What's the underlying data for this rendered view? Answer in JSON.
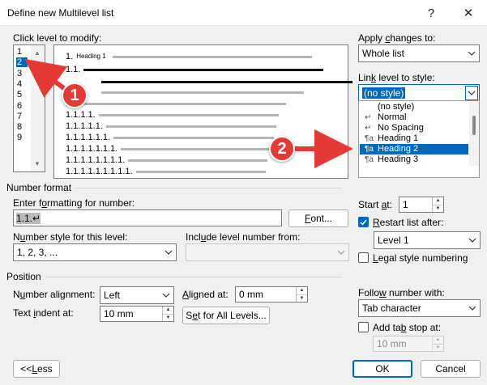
{
  "window": {
    "title": "Define new Multilevel list",
    "help": "?",
    "close": "✕"
  },
  "levels": {
    "label": "Click level to modify:",
    "items": [
      "1",
      "2",
      "3",
      "4",
      "5",
      "6",
      "7",
      "8",
      "9"
    ],
    "selected_index": 1
  },
  "preview": {
    "rows": [
      "1.",
      "1.1.",
      "",
      "",
      "1.",
      "1.1.",
      "1.1.1.1.",
      "1.1.1.1.1.",
      "1.1.1.1.1.1.",
      "1.1.1.1.1.1.1.",
      "1.1.1.1.1.1.1.1.",
      "1.1.1.1.1.1.1.1.1."
    ],
    "heading_label": "Heading 1"
  },
  "apply_changes": {
    "label": "Apply changes to:",
    "value": "Whole list"
  },
  "link_level": {
    "label": "Link level to style:",
    "value": "(no style)",
    "options": [
      "(no style)",
      "Normal",
      "No Spacing",
      "Heading 1",
      "Heading 2",
      "Heading 3"
    ],
    "option_icons": [
      "",
      "↵",
      "↵",
      "¶a",
      "¶a",
      "¶a"
    ],
    "selected_index": 4
  },
  "number_format": {
    "section": "Number format",
    "enter_label": "Enter formatting for number:",
    "format_value": "1.1.↵",
    "font_button": "Font...",
    "style_label": "Number style for this level:",
    "style_value": "1, 2, 3, ...",
    "include_label": "Include level number from:",
    "include_value": ""
  },
  "start_at": {
    "label": "Start at:",
    "value": "1"
  },
  "restart": {
    "label": "Restart list after:",
    "checked": true,
    "value": "Level 1"
  },
  "legal": {
    "label": "Legal style numbering",
    "checked": false
  },
  "position": {
    "section": "Position",
    "alignment_label": "Number alignment:",
    "alignment_value": "Left",
    "aligned_at_label": "Aligned at:",
    "aligned_at_value": "0 mm",
    "indent_label": "Text indent at:",
    "indent_value": "10 mm",
    "set_all_button": "Set for All Levels..."
  },
  "follow": {
    "label": "Follow number with:",
    "value": "Tab character"
  },
  "tab_stop": {
    "label": "Add tab stop at:",
    "checked": false,
    "value": "10 mm"
  },
  "buttons": {
    "less": "<< Less",
    "ok": "OK",
    "cancel": "Cancel"
  },
  "annotations": [
    "1",
    "2"
  ],
  "colors": {
    "accent": "#0067c0",
    "annotation": "#e53935"
  }
}
